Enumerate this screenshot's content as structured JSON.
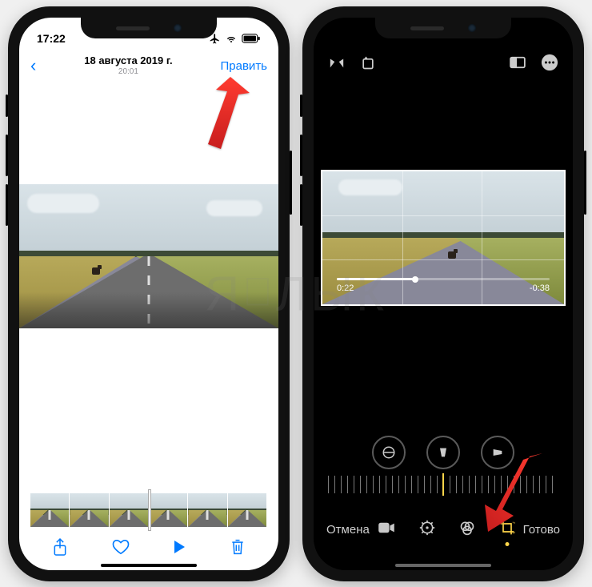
{
  "watermark": "ЯБЛЫК",
  "left": {
    "status": {
      "time": "17:22"
    },
    "nav": {
      "back_glyph": "‹",
      "date": "18 августа 2019 г.",
      "time": "20:01",
      "edit": "Править"
    },
    "toolbar": {
      "share": "share-icon",
      "like": "heart-icon",
      "play": "play-icon",
      "trash": "trash-icon"
    }
  },
  "right": {
    "top": {
      "flip": "flip-horizontal-icon",
      "rotate": "rotate-icon",
      "aspect": "aspect-icon",
      "more": "more-icon"
    },
    "playback": {
      "current": "0:22",
      "remaining": "-0:38"
    },
    "dials": {
      "straighten": "straighten-icon",
      "vertical": "vertical-perspective-icon",
      "horizontal": "horizontal-perspective-icon"
    },
    "bottom": {
      "cancel": "Отмена",
      "video": "video-icon",
      "adjust": "adjust-icon",
      "filters": "filters-icon",
      "crop": "crop-icon",
      "done": "Готово"
    }
  }
}
